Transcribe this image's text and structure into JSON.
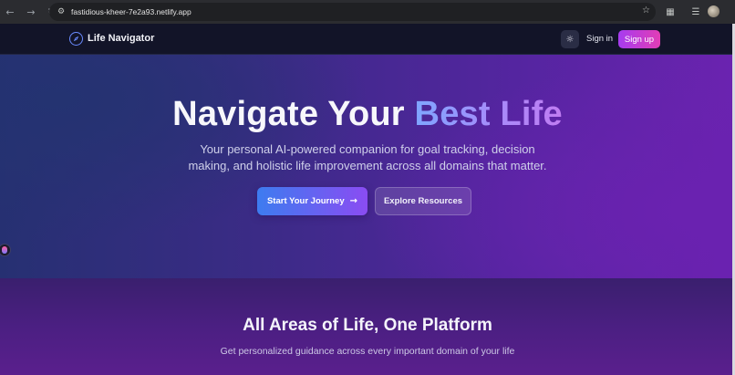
{
  "browser": {
    "url": "fastidious-kheer-7e2a93.netlify.app",
    "icons": {
      "back": "back-arrow-icon",
      "forward": "forward-arrow-icon",
      "reload": "reload-icon",
      "site_info": "site-info-icon",
      "bookmark": "star-icon",
      "extensions": "puzzle-icon",
      "media": "media-controls-icon",
      "account": "avatar-icon"
    }
  },
  "header": {
    "brand": "Life Navigator",
    "signin_label": "Sign in",
    "signup_label": "Sign up",
    "theme_icon": "sun-icon"
  },
  "hero": {
    "title_part1": "Navigate Your ",
    "title_accent": "Best Life",
    "subtitle": "Your personal AI-powered companion for goal tracking, decision making, and holistic life improvement across all domains that matter.",
    "primary_cta": "Start Your Journey",
    "secondary_cta": "Explore Resources"
  },
  "section2": {
    "title": "All Areas of Life, One Platform",
    "subtitle": "Get personalized guidance across every important domain of your life"
  },
  "colors": {
    "accent_blue": "#3d7cf0",
    "accent_purple": "#8a4cf2",
    "signup_pink": "#e23db5",
    "header_bg": "#121428"
  }
}
